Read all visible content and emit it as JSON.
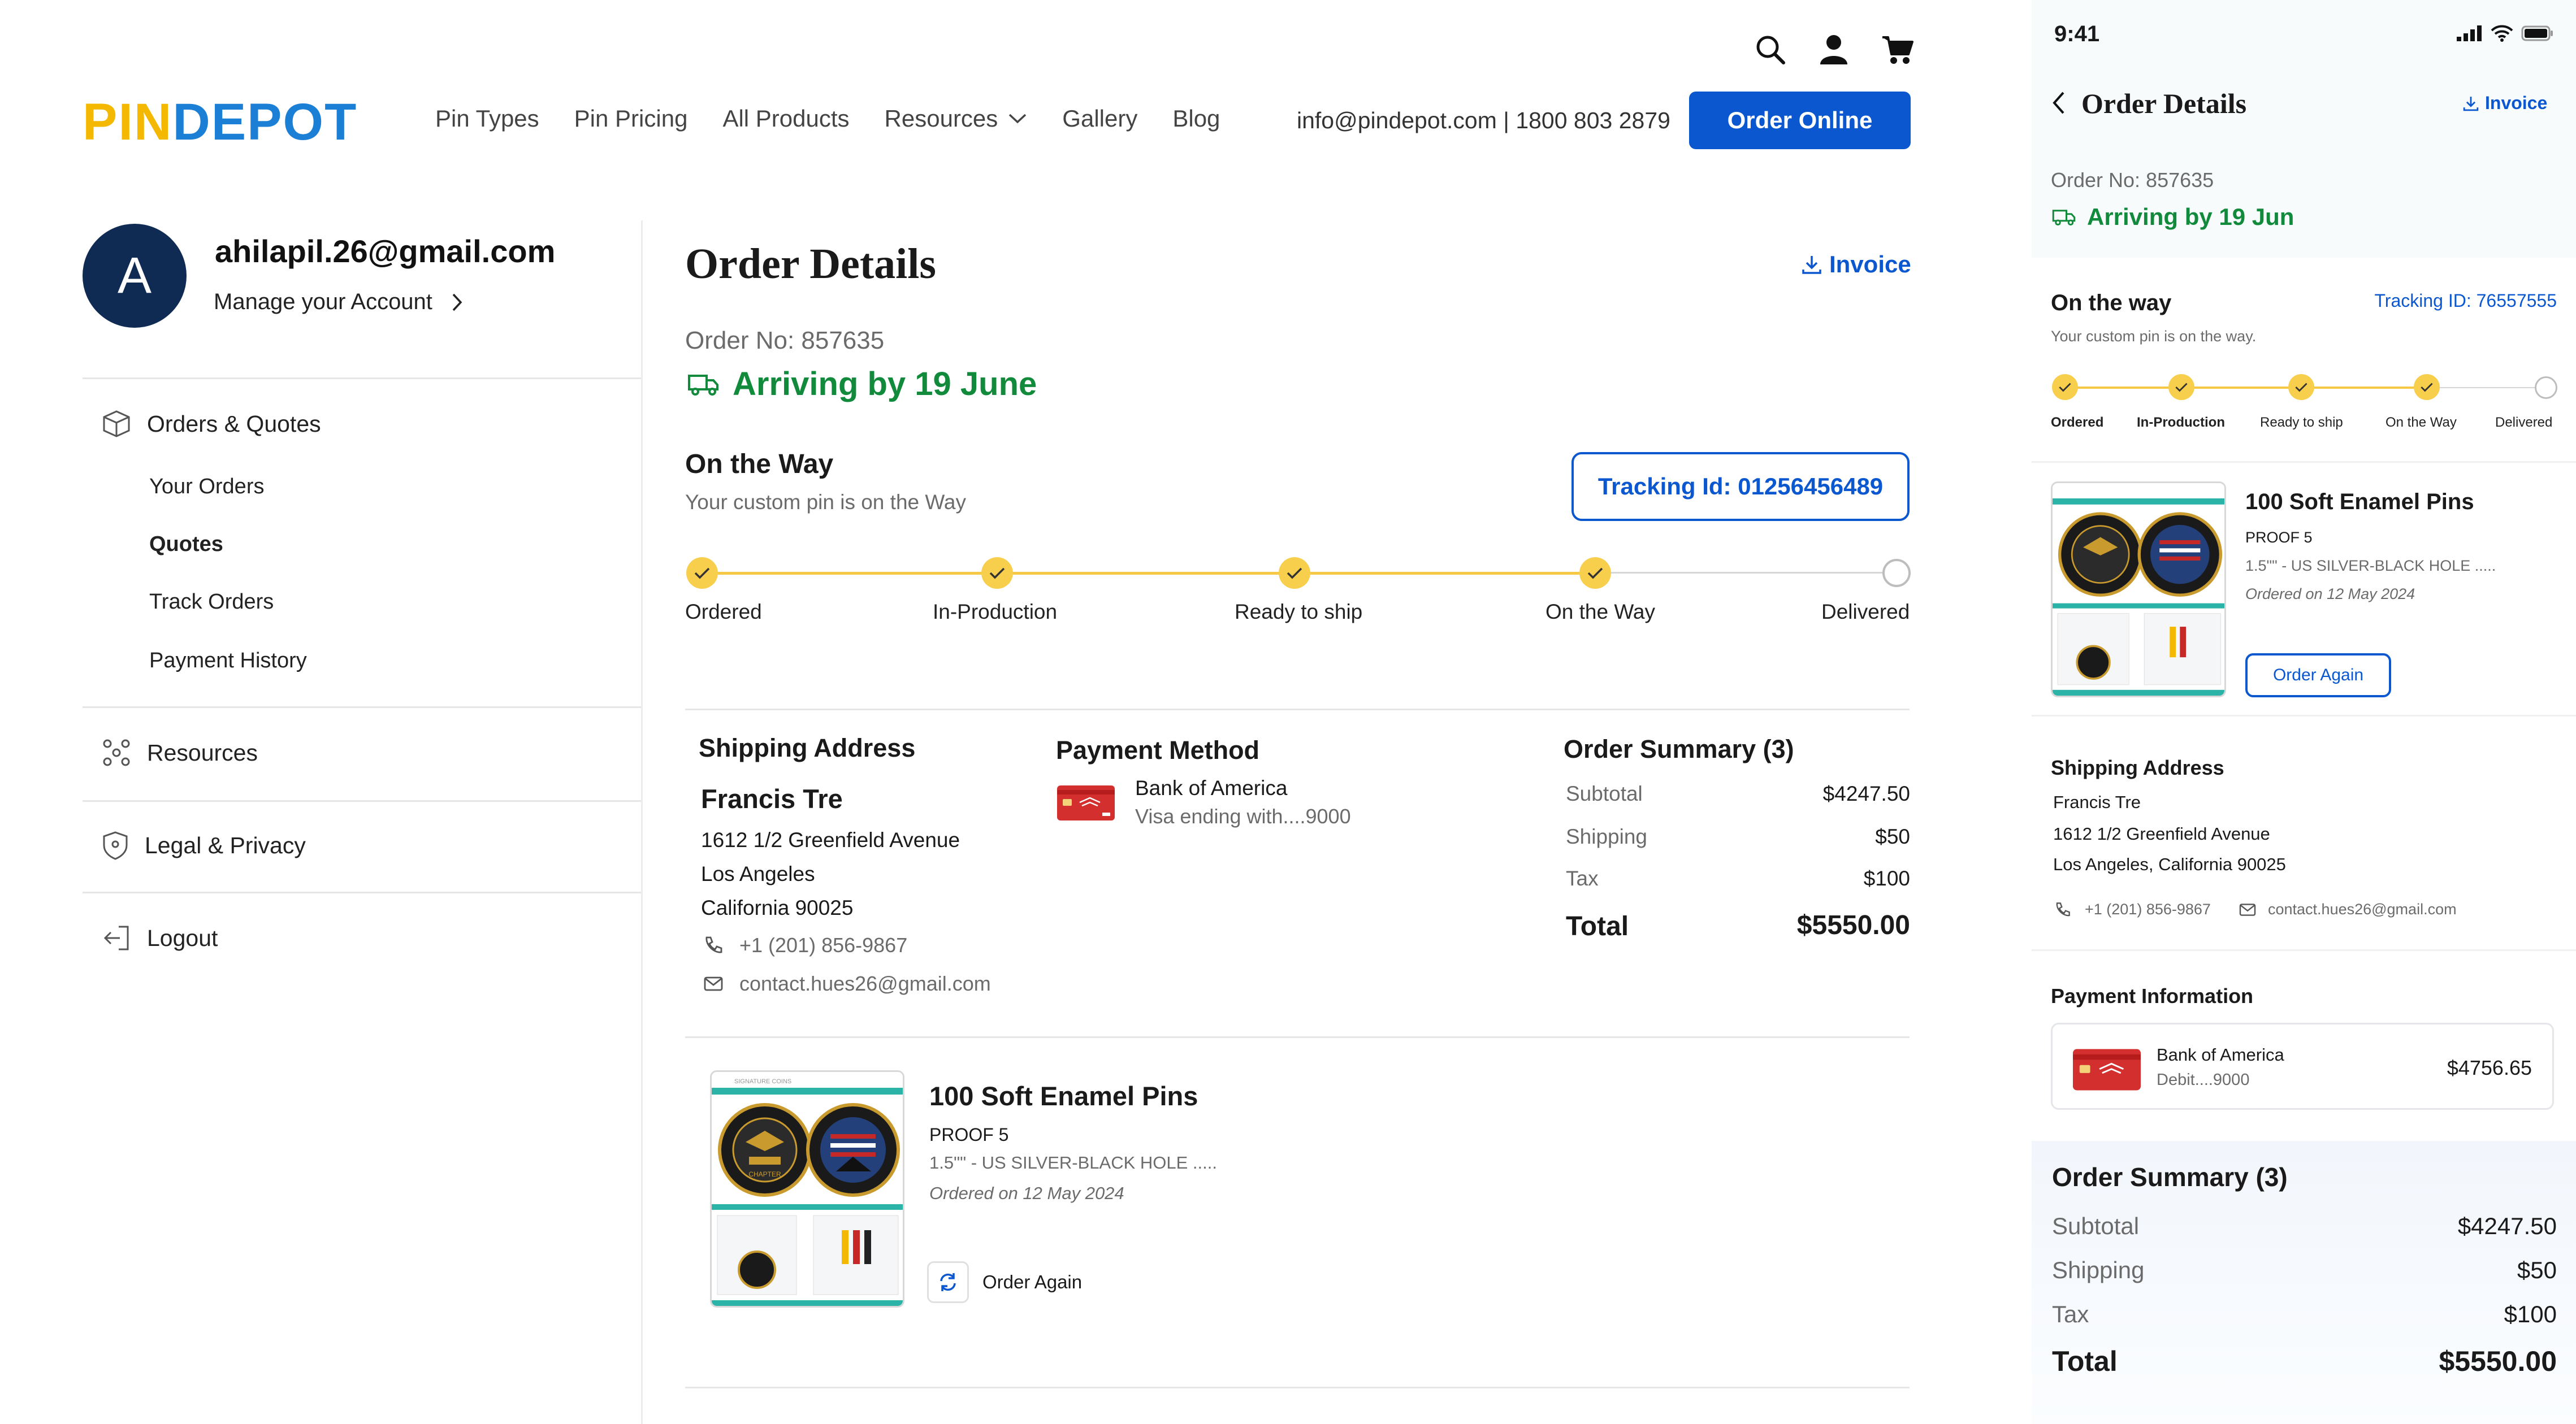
{
  "header": {
    "logo_part1": "PIN",
    "logo_part2": "DEPOT",
    "nav": [
      "Pin Types",
      "Pin Pricing",
      "All Products",
      "Resources",
      "Gallery",
      "Blog"
    ],
    "contact": "info@pindepot.com | 1800 803 2879",
    "order_online": "Order Online"
  },
  "account": {
    "avatar_letter": "A",
    "email": "ahilapil.26@gmail.com",
    "manage": "Manage your Account"
  },
  "sidebar": {
    "orders_quotes": "Orders & Quotes",
    "sub": [
      "Your Orders",
      "Quotes",
      "Track Orders",
      "Payment History"
    ],
    "resources": "Resources",
    "legal": "Legal & Privacy",
    "logout": "Logout"
  },
  "order": {
    "title": "Order Details",
    "invoice": "Invoice",
    "order_no": "Order No: 857635",
    "arriving": "Arriving by 19 June",
    "status_title": "On the Way",
    "status_sub": "Your custom pin is on the Way",
    "tracking": "Tracking Id: 01256456489",
    "steps": [
      "Ordered",
      "In-Production",
      "Ready to ship",
      "On the Way",
      "Delivered"
    ],
    "progress_completed": 4
  },
  "shipping": {
    "title": "Shipping Address",
    "name": "Francis Tre",
    "line1": "1612 1/2 Greenfield Avenue",
    "line2": "Los Angeles",
    "line3": "California 90025",
    "phone": "+1 (201) 856-9867",
    "email": "contact.hues26@gmail.com"
  },
  "payment": {
    "title": "Payment Method",
    "bank": "Bank of America",
    "card": "Visa ending with....9000"
  },
  "summary": {
    "title": "Order Summary (3)",
    "rows": [
      {
        "label": "Subtotal",
        "value": "$4247.50"
      },
      {
        "label": "Shipping",
        "value": "$50"
      },
      {
        "label": "Tax",
        "value": "$100"
      }
    ],
    "total_label": "Total",
    "total_value": "$5550.00"
  },
  "product": {
    "name": "100 Soft Enamel Pins",
    "proof": "PROOF 5",
    "spec": "1.5\"\" - US SILVER-BLACK HOLE .....",
    "ordered_on": "Ordered on 12 May 2024",
    "order_again": "Order Again",
    "chapter_text": "CHAPTER",
    "brand_text": "SIGNATURE COINS"
  },
  "mobile": {
    "time": "9:41",
    "title": "Order Details",
    "invoice": "Invoice",
    "order_no": "Order No: 857635",
    "arriving": "Arriving by 19 Jun",
    "status_title": "On the way",
    "tracking": "Tracking ID: 76557555",
    "status_sub": "Your custom pin is on the way.",
    "steps": [
      "Ordered",
      "In-Production",
      "Ready to ship",
      "On the Way",
      "Delivered"
    ],
    "product_name": "100 Soft Enamel Pins",
    "proof": "PROOF 5",
    "spec": "1.5\"\" - US SILVER-BLACK HOLE .....",
    "ordered_on": "Ordered on 12 May 2024",
    "order_again": "Order Again",
    "ship_title": "Shipping Address",
    "ship_name": "Francis Tre",
    "ship_line1": "1612 1/2 Greenfield Avenue",
    "ship_line2": "Los Angeles, California 90025",
    "phone": "+1 (201) 856-9867",
    "email": "contact.hues26@gmail.com",
    "payment_title": "Payment Information",
    "bank": "Bank of America",
    "card": "Debit....9000",
    "amount": "$4756.65",
    "summary_title": "Order Summary (3)",
    "rows": [
      {
        "label": "Subtotal",
        "value": "$4247.50"
      },
      {
        "label": "Shipping",
        "value": "$50"
      },
      {
        "label": "Tax",
        "value": "$100"
      }
    ],
    "total_label": "Total",
    "total_value": "$5550.00"
  },
  "colors": {
    "primary": "#0b57d0",
    "success": "#118a3b",
    "progress": "#f6c843",
    "avatar": "#0f2a53",
    "card_red": "#d32f2f"
  }
}
